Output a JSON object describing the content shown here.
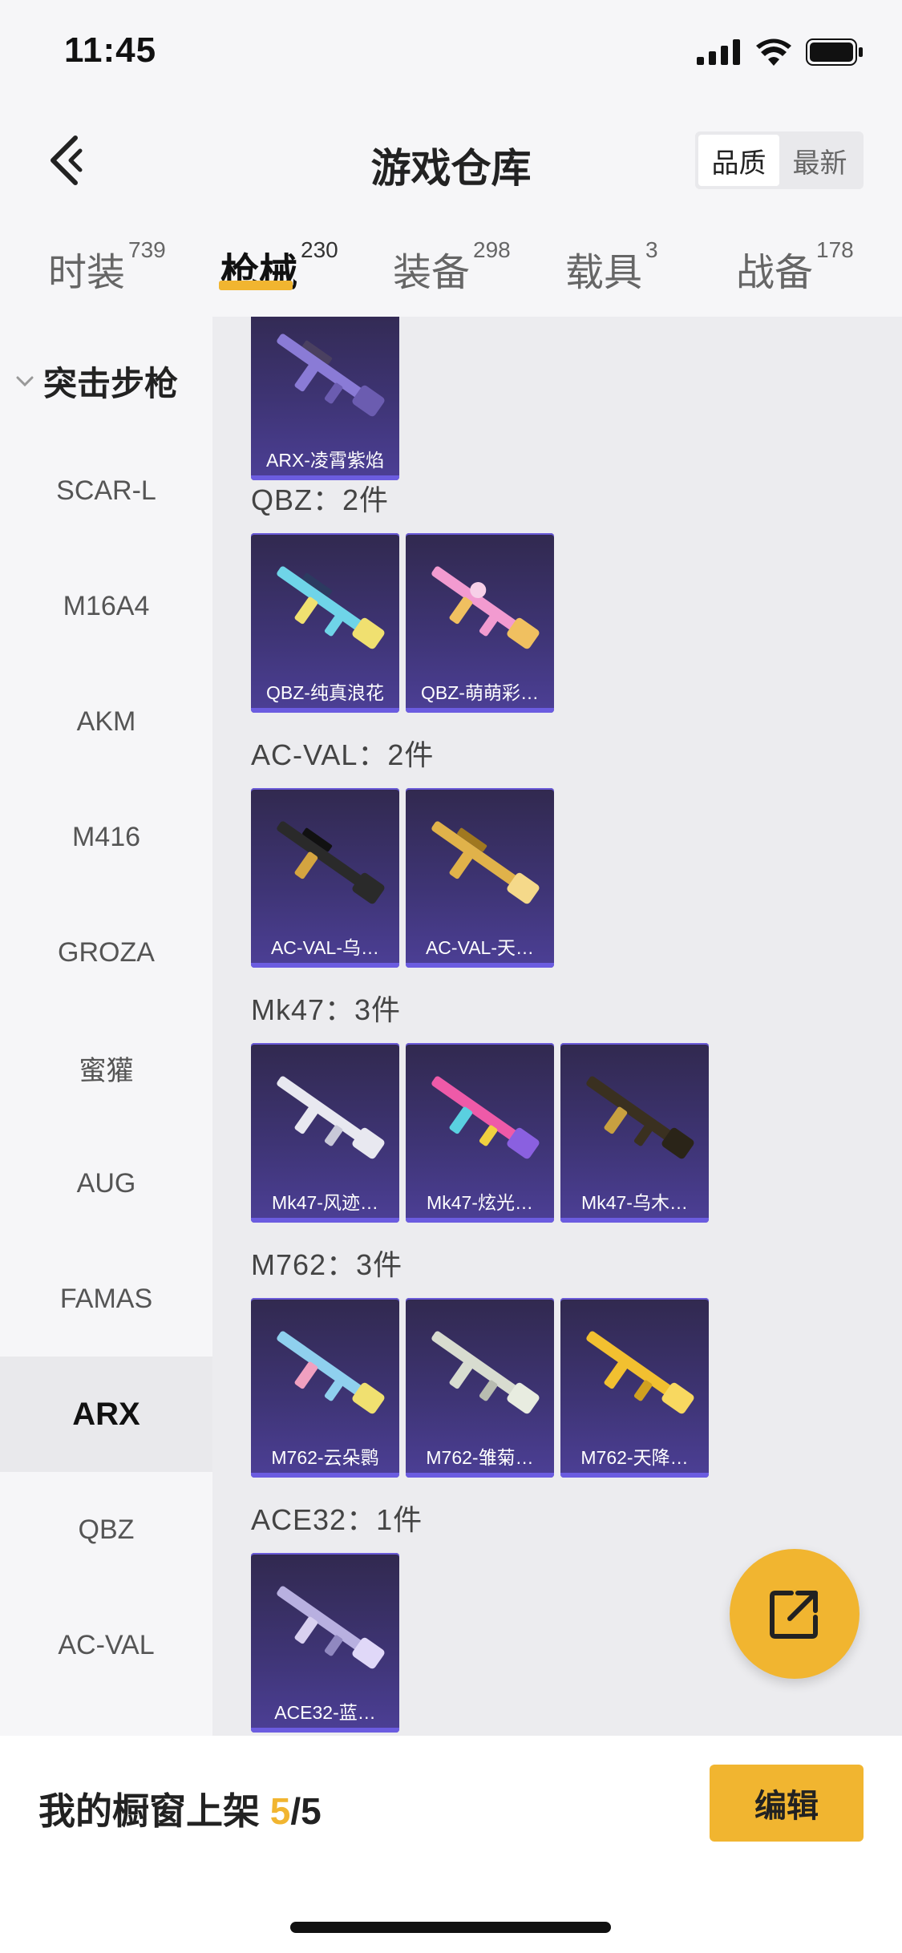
{
  "status_bar": {
    "time": "11:45"
  },
  "header": {
    "title": "游戏仓库",
    "sort": [
      "品质",
      "最新"
    ]
  },
  "tabs": [
    {
      "label": "时装",
      "count": "739"
    },
    {
      "label": "枪械",
      "count": "230"
    },
    {
      "label": "装备",
      "count": "298"
    },
    {
      "label": "载具",
      "count": "3"
    },
    {
      "label": "战备",
      "count": "178"
    }
  ],
  "sidebar": {
    "category": "突击步枪",
    "items": [
      "SCAR-L",
      "M16A4",
      "AKM",
      "M416",
      "GROZA",
      "蜜獾",
      "AUG",
      "FAMAS",
      "ARX",
      "QBZ",
      "AC-VAL"
    ],
    "active": "ARX"
  },
  "groups": [
    {
      "title": "",
      "items": [
        {
          "name": "ARX-凌霄紫焰",
          "color": "#8a7bd6"
        }
      ]
    },
    {
      "title": "QBZ：2件",
      "items": [
        {
          "name": "QBZ-纯真浪花",
          "color": "#6fd4e8"
        },
        {
          "name": "QBZ-萌萌彩…",
          "color": "#f29bd0"
        }
      ]
    },
    {
      "title": "AC-VAL：2件",
      "items": [
        {
          "name": "AC-VAL-乌…",
          "color": "#2a2a2a"
        },
        {
          "name": "AC-VAL-天…",
          "color": "#e0b24a"
        }
      ]
    },
    {
      "title": "Mk47：3件",
      "items": [
        {
          "name": "Mk47-风迹…",
          "color": "#e8e8f0"
        },
        {
          "name": "Mk47-炫光…",
          "color": "#ee5aa8"
        },
        {
          "name": "Mk47-乌木…",
          "color": "#3a3020"
        }
      ]
    },
    {
      "title": "M762：3件",
      "items": [
        {
          "name": "M762-云朵鹮",
          "color": "#8fd0ee"
        },
        {
          "name": "M762-雏菊…",
          "color": "#d8dcd0"
        },
        {
          "name": "M762-天降…",
          "color": "#f2c030"
        }
      ]
    },
    {
      "title": "ACE32：1件",
      "items": [
        {
          "name": "ACE32-蓝…",
          "color": "#b8b0e0"
        }
      ]
    }
  ],
  "bottom": {
    "label": "我的橱窗上架",
    "count": "5",
    "total": "/5",
    "edit": "编辑"
  },
  "colors": {
    "accent": "#f1b530",
    "card_bg": "#3e3474"
  }
}
